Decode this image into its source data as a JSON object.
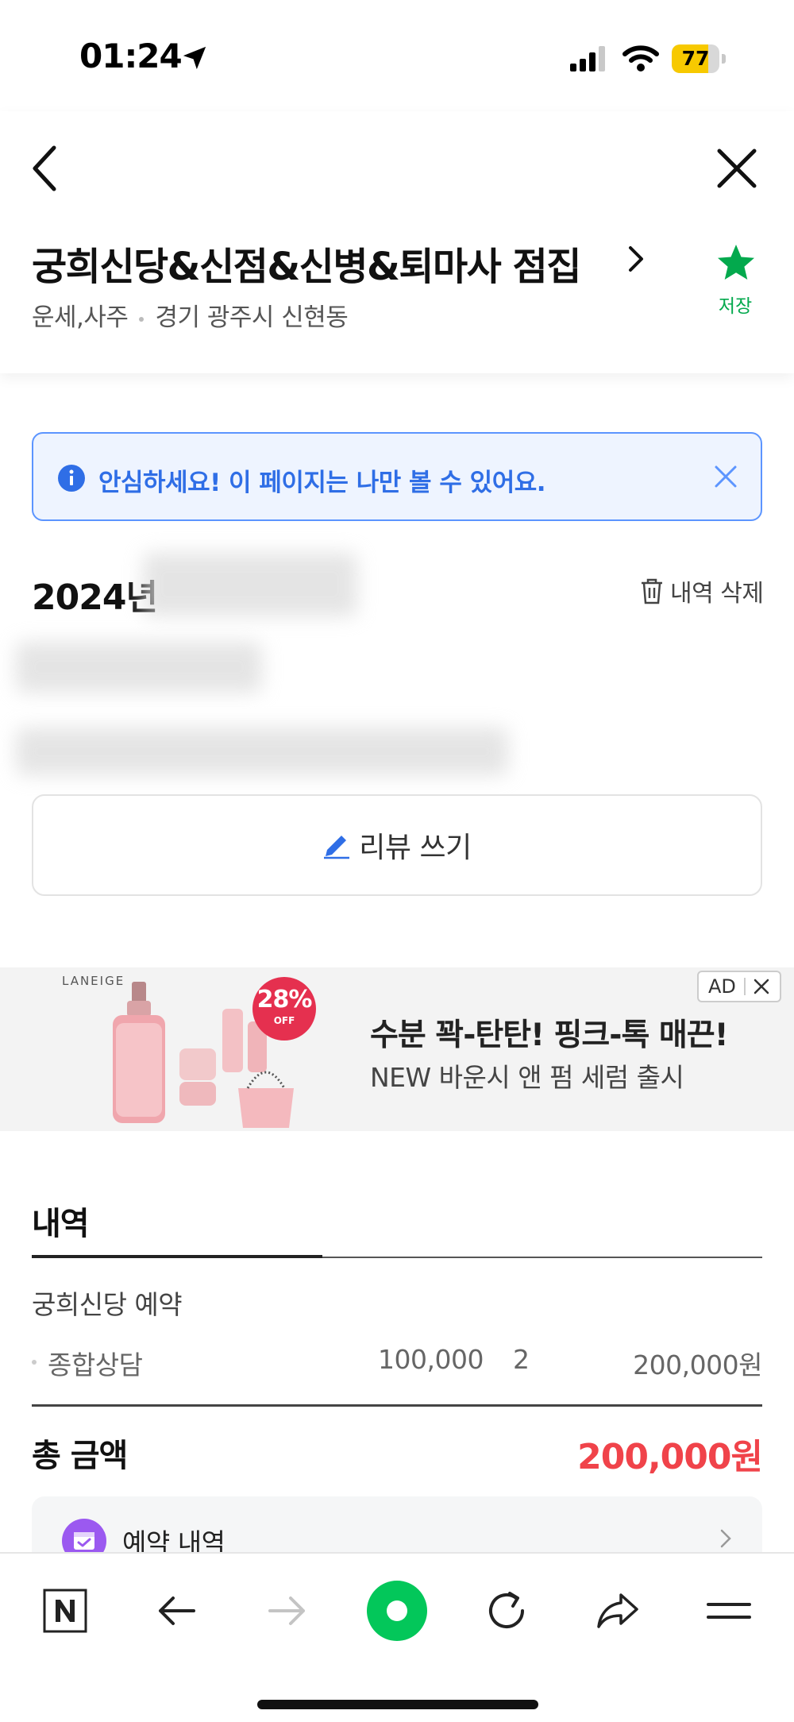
{
  "status_bar": {
    "time": "01:24",
    "battery": "77",
    "battery_level": 0.77,
    "colors": {
      "battery_fill": "#f7c900"
    }
  },
  "header": {
    "title": "궁희신당&신점&신병&퇴마사 점집",
    "category": "운세,사주",
    "address": "경기 광주시 신현동",
    "save_label": "저장",
    "icons": [
      "back-icon",
      "close-icon",
      "chevron-right-icon",
      "star-icon"
    ],
    "colors": {
      "save": "#03a94d"
    }
  },
  "notice": {
    "text": "안심하세요! 이 페이지는 나만 볼 수 있어요.",
    "colors": {
      "accent": "#2f6ee6",
      "background": "#eef4ff"
    }
  },
  "booking": {
    "date_prefix": "2024년",
    "delete_label": "내역 삭제",
    "review_label": "리뷰 쓰기"
  },
  "ad": {
    "brand": "LANEIGE",
    "badge": "28%",
    "badge_sub": "OFF",
    "headline": "수분 꽉-탄탄! 핑크-톡 매끈!",
    "subline": "NEW 바운시 앤 펌 세럼 출시",
    "mark": "AD"
  },
  "details": {
    "title": "내역",
    "shop_line": "궁희신당 예약",
    "items": [
      {
        "name": "종합상담",
        "price": "100,000",
        "qty": "2",
        "total": "200,000원"
      }
    ],
    "total_label": "총 금액",
    "total_value": "200,000원",
    "history_label": "예약 내역",
    "colors": {
      "total": "#f0434a",
      "history_icon": "#9b59f0"
    }
  },
  "toolbar": {
    "icons": [
      "naver-n-icon",
      "back-arrow-icon",
      "forward-arrow-icon",
      "green-dot-icon",
      "refresh-icon",
      "share-icon",
      "menu-icon"
    ],
    "colors": {
      "green": "#03c75a"
    }
  }
}
